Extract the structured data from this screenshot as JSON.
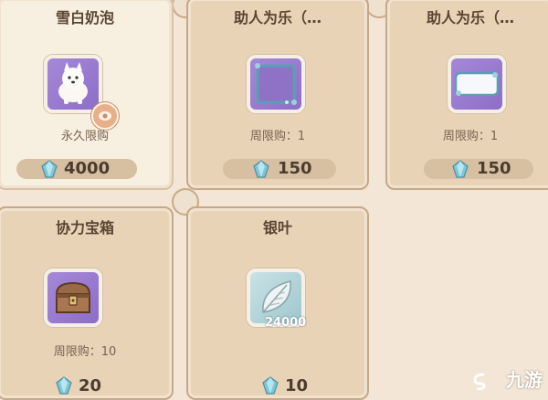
{
  "items": [
    {
      "title": "雪白奶泡",
      "limit": "永久限购",
      "price": "4000",
      "icon": "white-dog-icon",
      "frame": "purple"
    },
    {
      "title": "助人为乐（…",
      "limit": "周限购：1",
      "price": "150",
      "icon": "photo-frame-icon",
      "frame": "purple"
    },
    {
      "title": "助人为乐（…",
      "limit": "周限购：1",
      "price": "150",
      "icon": "nameplate-frame-icon",
      "frame": "purple"
    },
    {
      "title": "协力宝箱",
      "limit": "周限购：10",
      "price": "20",
      "icon": "treasure-chest-icon",
      "frame": "purple"
    },
    {
      "title": "银叶",
      "limit": "",
      "price": "10",
      "icon": "silver-leaf-icon",
      "frame": "teal",
      "count": "24000"
    }
  ],
  "currency_icon": "crystal-gem-icon",
  "watermark": "九游",
  "colors": {
    "card_bg": "#e8d3b7",
    "selected_card_bg": "#f7efe0",
    "purple_frame": "#9a7bd0",
    "teal_frame": "#b5d6db",
    "price_text": "#4c3c30"
  }
}
